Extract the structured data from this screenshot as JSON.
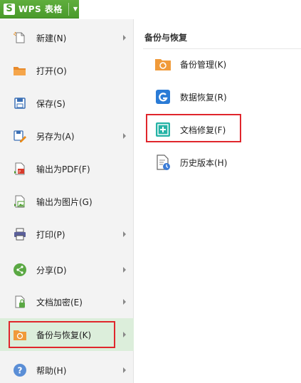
{
  "app": {
    "logo": "S",
    "title": "WPS 表格"
  },
  "menu": {
    "items": [
      {
        "label": "新建(N)",
        "icon": "new-file-icon",
        "has_submenu": true
      },
      {
        "label": "打开(O)",
        "icon": "open-folder-icon",
        "has_submenu": false
      },
      {
        "label": "保存(S)",
        "icon": "save-icon",
        "has_submenu": false
      },
      {
        "label": "另存为(A)",
        "icon": "save-as-icon",
        "has_submenu": true
      },
      {
        "label": "输出为PDF(F)",
        "icon": "export-pdf-icon",
        "has_submenu": false
      },
      {
        "label": "输出为图片(G)",
        "icon": "export-image-icon",
        "has_submenu": false
      },
      {
        "label": "打印(P)",
        "icon": "printer-icon",
        "has_submenu": true
      },
      {
        "label": "分享(D)",
        "icon": "share-icon",
        "has_submenu": true
      },
      {
        "label": "文档加密(E)",
        "icon": "encrypt-icon",
        "has_submenu": true
      },
      {
        "label": "备份与恢复(K)",
        "icon": "backup-restore-icon",
        "has_submenu": true,
        "active": true
      },
      {
        "label": "帮助(H)",
        "icon": "help-icon",
        "has_submenu": true
      }
    ]
  },
  "submenu": {
    "title": "备份与恢复",
    "items": [
      {
        "label": "备份管理(K)",
        "icon": "backup-manage-icon"
      },
      {
        "label": "数据恢复(R)",
        "icon": "data-recovery-icon"
      },
      {
        "label": "文档修复(F)",
        "icon": "document-repair-icon",
        "highlighted": true
      },
      {
        "label": "历史版本(H)",
        "icon": "history-version-icon"
      }
    ]
  },
  "colors": {
    "accent": "#4a9a2b",
    "highlight": "#e0262c",
    "active_bg": "#dceedb"
  }
}
